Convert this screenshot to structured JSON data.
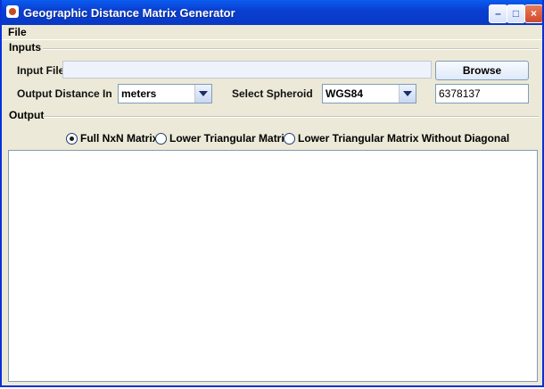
{
  "window": {
    "title": "Geographic Distance Matrix Generator"
  },
  "menu": {
    "file": "File"
  },
  "inputs": {
    "section": "Inputs",
    "input_file_label": "Input File",
    "input_file_value": "",
    "browse": "Browse",
    "output_distance_label": "Output Distance In",
    "output_distance_value": "meters",
    "spheroid_label": "Select Spheroid",
    "spheroid_value": "WGS84",
    "radius_value": "6378137"
  },
  "output": {
    "section": "Output",
    "options": [
      "Full NxN Matrix",
      "Lower Triangular Matrix",
      "Lower Triangular Matrix Without Diagonal"
    ],
    "selected_index": 0,
    "content": ""
  },
  "colors": {
    "titlebar": "#0a4ee0",
    "accent": "#0831d9",
    "background": "#ece9d8"
  }
}
